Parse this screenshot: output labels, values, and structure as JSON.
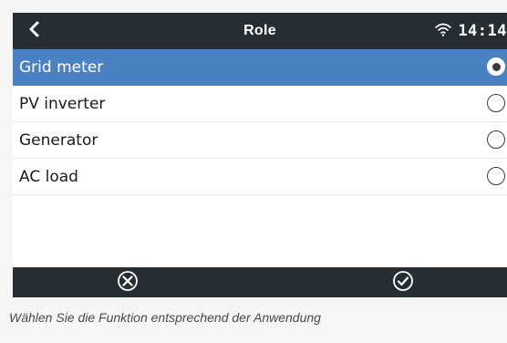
{
  "header": {
    "title": "Role",
    "time": "14:14"
  },
  "options": [
    {
      "label": "Grid meter",
      "selected": true
    },
    {
      "label": "PV inverter",
      "selected": false
    },
    {
      "label": "Generator",
      "selected": false
    },
    {
      "label": "AC load",
      "selected": false
    }
  ],
  "icons": {
    "back": "chevron-left-icon",
    "wifi": "wifi-icon",
    "cancel": "cancel-circle-icon",
    "confirm": "check-circle-icon"
  },
  "colors": {
    "header_bg": "#262d33",
    "selected_bg": "#4a81c3"
  },
  "caption": "Wählen Sie die Funktion entsprechend der Anwendung"
}
